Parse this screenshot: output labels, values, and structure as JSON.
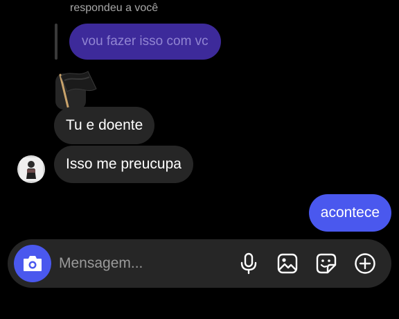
{
  "thread": {
    "reply_note": "respondeu a você",
    "quoted_message": "vou fazer isso com vc",
    "received": [
      {
        "text": "Tu e doente"
      },
      {
        "text": "Isso me preucupa"
      }
    ],
    "sent": [
      {
        "text": "acontece"
      }
    ],
    "reaction": "black-flag-sticker"
  },
  "composer": {
    "placeholder": "Mensagem...",
    "value": "",
    "icons": [
      "camera-icon",
      "microphone-icon",
      "gallery-icon",
      "sticker-icon",
      "plus-circle-icon"
    ]
  },
  "colors": {
    "background": "#000000",
    "received_bubble": "#262626",
    "sent_bubble": "#4a58ee",
    "quoted_bubble": "#3d2a9a",
    "composer": "#262626"
  }
}
